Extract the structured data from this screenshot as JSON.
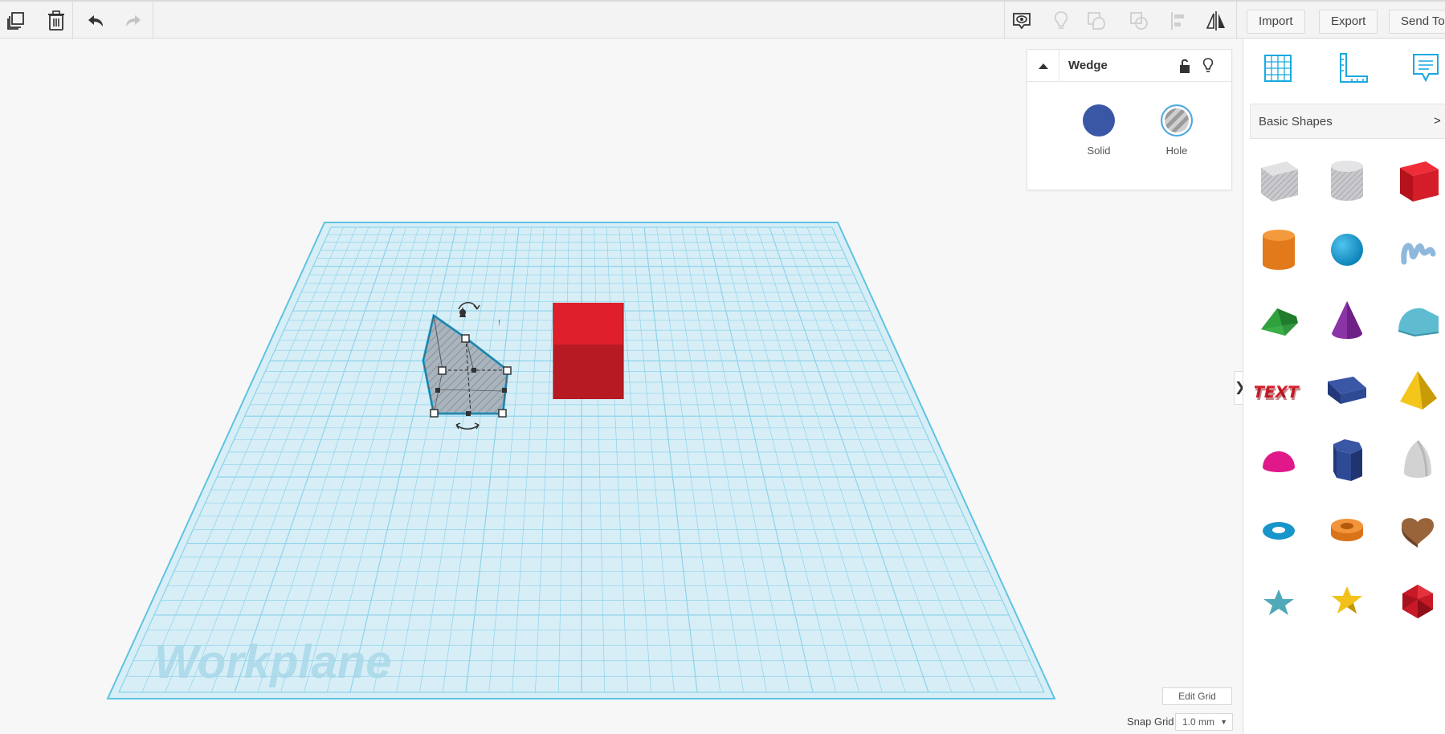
{
  "toolbar": {
    "left_icons": [
      "copy-icon",
      "trash-icon",
      "undo-icon",
      "redo-icon"
    ],
    "right_icons": [
      "eye-icon",
      "lightbulb-icon",
      "group-icon",
      "ungroup-icon",
      "align-icon",
      "mirror-icon"
    ],
    "import_label": "Import",
    "export_label": "Export",
    "send_to_label": "Send To"
  },
  "inspector": {
    "title": "Wedge",
    "solid_label": "Solid",
    "hole_label": "Hole",
    "solid_color": "#3a57a6"
  },
  "workplane": {
    "label": "Workplane",
    "grid_color": "#7ecfe6",
    "edit_grid_label": "Edit Grid",
    "snap_grid_label": "Snap Grid",
    "snap_grid_value": "1.0 mm"
  },
  "panel": {
    "tool_icons": [
      "grid-icon",
      "ruler-icon",
      "notes-icon"
    ],
    "category_label": "Basic Shapes",
    "category_arrow": ">",
    "collapse_label": "❯",
    "shapes": [
      "box-hole",
      "cylinder-hole",
      "box",
      "cylinder",
      "sphere",
      "scribble",
      "roof",
      "cone",
      "round-roof",
      "text",
      "wedge",
      "pyramid",
      "half-sphere",
      "polygon",
      "paraboloid",
      "torus",
      "tube",
      "heart",
      "star",
      "star-yellow",
      "icosahedron"
    ]
  },
  "colors": {
    "accent": "#1aa9e0",
    "red_box": "#d0202e"
  }
}
